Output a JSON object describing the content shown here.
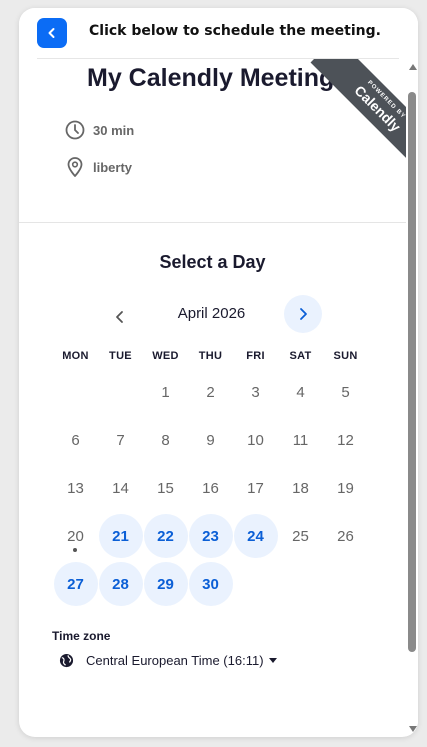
{
  "header": {
    "title": "Click below to schedule the meeting."
  },
  "event": {
    "title": "My Calendly Meeting",
    "duration": "30 min",
    "location": "liberty"
  },
  "ribbon": {
    "top": "POWERED BY",
    "brand": "Calendly"
  },
  "calendar": {
    "heading": "Select a Day",
    "month": "April 2026",
    "weekdays": [
      "MON",
      "TUE",
      "WED",
      "THU",
      "FRI",
      "SAT",
      "SUN"
    ],
    "days": [
      {
        "n": "",
        "a": false
      },
      {
        "n": "",
        "a": false
      },
      {
        "n": "1",
        "a": false
      },
      {
        "n": "2",
        "a": false
      },
      {
        "n": "3",
        "a": false
      },
      {
        "n": "4",
        "a": false
      },
      {
        "n": "5",
        "a": false
      },
      {
        "n": "6",
        "a": false
      },
      {
        "n": "7",
        "a": false
      },
      {
        "n": "8",
        "a": false
      },
      {
        "n": "9",
        "a": false
      },
      {
        "n": "10",
        "a": false
      },
      {
        "n": "11",
        "a": false
      },
      {
        "n": "12",
        "a": false
      },
      {
        "n": "13",
        "a": false
      },
      {
        "n": "14",
        "a": false
      },
      {
        "n": "15",
        "a": false
      },
      {
        "n": "16",
        "a": false
      },
      {
        "n": "17",
        "a": false
      },
      {
        "n": "18",
        "a": false
      },
      {
        "n": "19",
        "a": false
      },
      {
        "n": "20",
        "a": false,
        "today": true
      },
      {
        "n": "21",
        "a": true
      },
      {
        "n": "22",
        "a": true
      },
      {
        "n": "23",
        "a": true
      },
      {
        "n": "24",
        "a": true
      },
      {
        "n": "25",
        "a": false
      },
      {
        "n": "26",
        "a": false
      },
      {
        "n": "27",
        "a": true
      },
      {
        "n": "28",
        "a": true
      },
      {
        "n": "29",
        "a": true
      },
      {
        "n": "30",
        "a": true
      }
    ]
  },
  "timezone": {
    "label": "Time zone",
    "value": "Central European Time (16:11)"
  },
  "colors": {
    "accent": "#0b6cf5",
    "available_bg": "#eaf2fe",
    "available_text": "#0b5fd6",
    "ribbon": "#4d5258"
  },
  "icons": {
    "back": "chevron-left-icon",
    "duration": "clock-icon",
    "location": "location-pin-icon",
    "timezone": "globe-icon"
  }
}
